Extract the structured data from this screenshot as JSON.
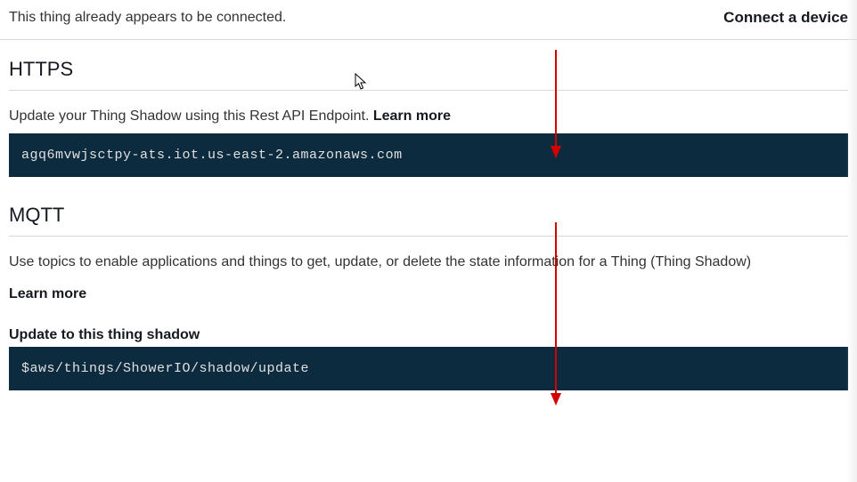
{
  "top": {
    "status": "This thing already appears to be connected.",
    "connect": "Connect a device"
  },
  "https": {
    "heading": "HTTPS",
    "description": "Update your Thing Shadow using this Rest API Endpoint. ",
    "learn_more": "Learn more",
    "endpoint": "agq6mvwjsctpy-ats.iot.us-east-2.amazonaws.com"
  },
  "mqtt": {
    "heading": "MQTT",
    "description": "Use topics to enable applications and things to get, update, or delete the state information for a Thing (Thing Shadow)",
    "learn_more": "Learn more",
    "update_label": "Update to this thing shadow",
    "update_topic": "$aws/things/ShowerIO/shadow/update"
  },
  "annotations": {
    "arrow_color": "#d40000"
  }
}
